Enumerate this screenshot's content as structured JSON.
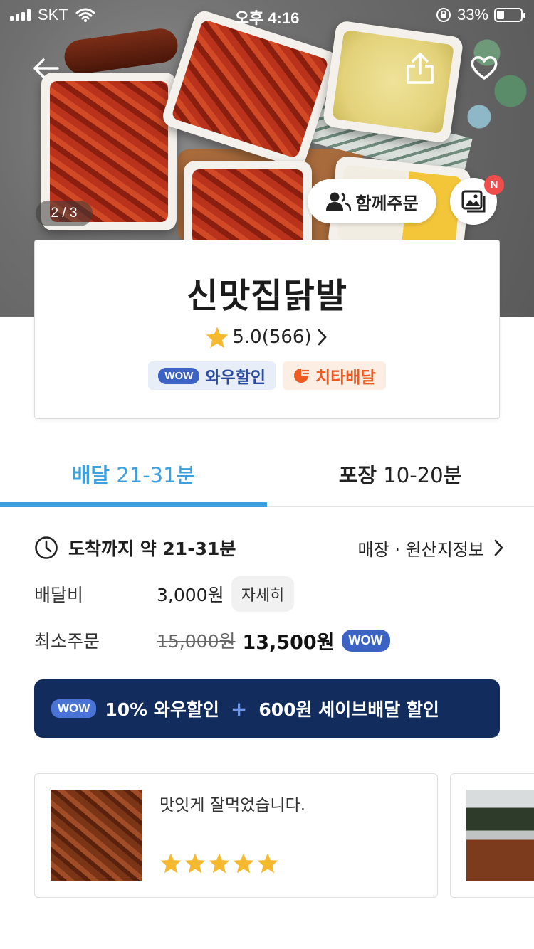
{
  "status_bar": {
    "carrier": "SKT",
    "time": "오후 4:16",
    "battery": "33%"
  },
  "hero": {
    "image_counter": "2 / 3",
    "group_order_label": "함께주문",
    "new_badge": "N"
  },
  "store": {
    "name": "신맛집닭발",
    "rating": "5.0(566)",
    "wow_pill": "WOW",
    "wow_badge_label": "와우할인",
    "cheetah_badge_label": "치타배달"
  },
  "tabs": [
    {
      "bold": "배달",
      "text": " 21-31분",
      "active": true
    },
    {
      "bold": "포장",
      "text": " 10-20분",
      "active": false
    }
  ],
  "info": {
    "arrival": "도착까지 약 21-31분",
    "store_info_link": "매장 · 원산지정보",
    "delivery_fee_label": "배달비",
    "delivery_fee_value": "3,000원",
    "detail_button": "자세히",
    "min_order_label": "최소주문",
    "min_order_original": "15,000원",
    "min_order_discounted": "13,500원",
    "wow_pill": "WOW"
  },
  "promo": {
    "wow_pill": "WOW",
    "part1": "10% 와우할인",
    "plus": "+",
    "part2": "600원 세이브배달 할인"
  },
  "reviews": [
    {
      "text": "맛잇게 잘먹었습니다.",
      "stars": 5
    }
  ],
  "colors": {
    "accent_blue": "#3e9fdf",
    "promo_navy": "#132c5e",
    "wow_blue": "#3c63c3",
    "cheetah_orange": "#ef5a22",
    "star_yellow": "#f5b82e"
  }
}
